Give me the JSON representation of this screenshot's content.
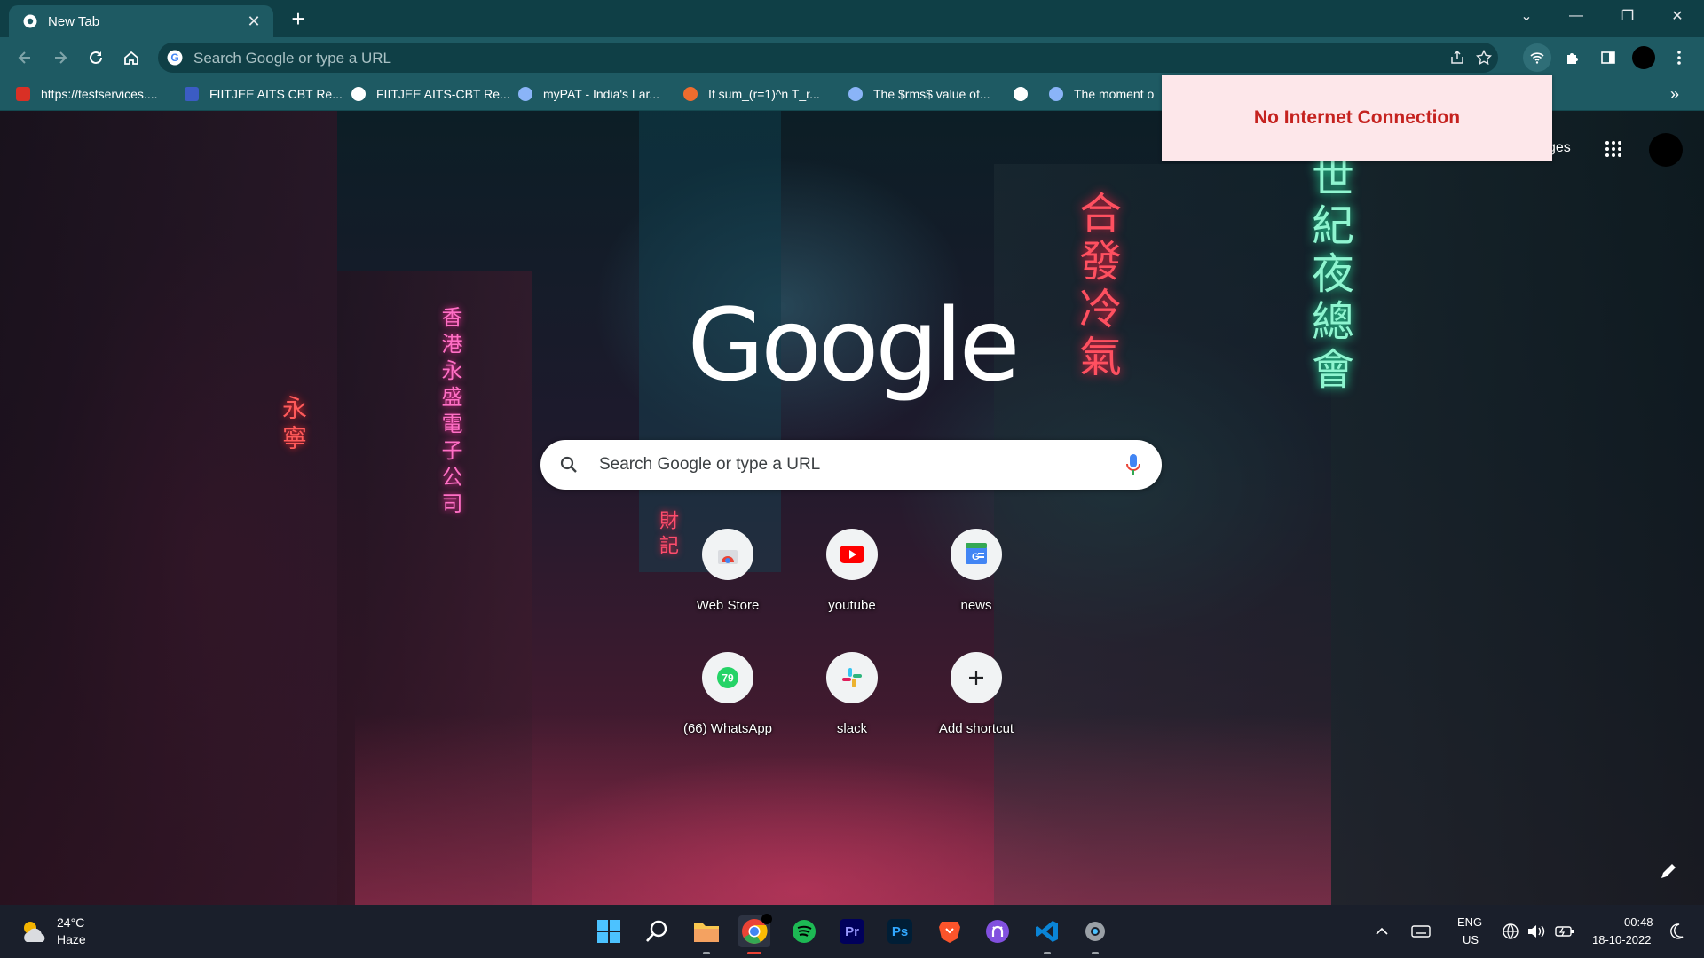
{
  "tab": {
    "title": "New Tab",
    "close": "✕",
    "new_tab": "+"
  },
  "window_controls": {
    "collapse": "⌄",
    "minimize": "—",
    "restore": "❐",
    "close": "✕"
  },
  "omnibox": {
    "placeholder": "Search Google or type a URL"
  },
  "bookmarks": [
    {
      "label": "https://testservices....",
      "icon": "pdf-icon",
      "color": "#d93025"
    },
    {
      "label": "FIITJEE AITS CBT Re...",
      "icon": "fiitjee-icon",
      "color": "#3b5cc4"
    },
    {
      "label": "FIITJEE AITS-CBT Re...",
      "icon": "globe-icon",
      "color": "#ffffff"
    },
    {
      "label": "myPAT - India's Lar...",
      "icon": "mypat-icon",
      "color": "#8ab4f8"
    },
    {
      "label": "If sum_(r=1)^n T_r...",
      "icon": "doubtnut-icon",
      "color": "#ef6c2e"
    },
    {
      "label": "The $rms$ value of...",
      "icon": "site-icon",
      "color": "#8ab4f8"
    },
    {
      "label": "",
      "icon": "globe-icon",
      "color": "#ffffff"
    },
    {
      "label": "The moment o",
      "icon": "site-icon",
      "color": "#8ab4f8"
    }
  ],
  "bookmarks_overflow": "»",
  "notification": {
    "text": "No Internet Connection"
  },
  "top_right": {
    "images_label": "ges"
  },
  "search": {
    "placeholder": "Search Google or type a URL"
  },
  "logo_text": "Google",
  "shortcuts": [
    {
      "label": "Web Store",
      "icon": "webstore-icon"
    },
    {
      "label": "youtube",
      "icon": "youtube-icon"
    },
    {
      "label": "news",
      "icon": "google-news-icon"
    },
    {
      "label": "(66) WhatsApp",
      "icon": "whatsapp-icon",
      "badge": "79"
    },
    {
      "label": "slack",
      "icon": "slack-icon"
    },
    {
      "label": "Add shortcut",
      "icon": "plus-icon"
    }
  ],
  "taskbar": {
    "weather": {
      "temp": "24°C",
      "condition": "Haze"
    },
    "apps": [
      "windows-start-icon",
      "search-icon",
      "file-explorer-icon",
      "chrome-icon",
      "spotify-icon",
      "premiere-pro-icon",
      "photoshop-icon",
      "brave-icon",
      "github-desktop-icon",
      "vscode-icon",
      "settings-icon"
    ],
    "premiere_label": "Pr",
    "photoshop_label": "Ps",
    "lang_line1": "ENG",
    "lang_line2": "US",
    "time": "00:48",
    "date": "18-10-2022"
  },
  "colors": {
    "titlebar": "#0f3f46",
    "toolbar": "#1e5a63",
    "notification_bg": "#fde7ea",
    "notification_text": "#c5221f"
  }
}
